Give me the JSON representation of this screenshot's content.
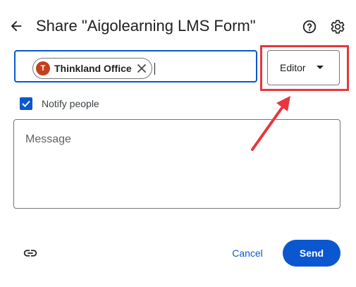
{
  "header": {
    "title": "Share \"Aigolearning LMS Form\""
  },
  "recipients": {
    "chips": [
      {
        "avatar_letter": "T",
        "label": "Thinkland Office",
        "avatar_color": "#c5401c"
      }
    ]
  },
  "role": {
    "selected": "Editor"
  },
  "notify": {
    "label": "Notify people",
    "checked": true
  },
  "message": {
    "placeholder": "Message"
  },
  "footer": {
    "cancel_label": "Cancel",
    "send_label": "Send"
  },
  "colors": {
    "accent": "#0b57d0",
    "annotation": "#e8363e"
  },
  "icons": {
    "back": "arrow-back-icon",
    "help": "help-icon",
    "settings": "gear-icon",
    "remove_chip": "close-icon",
    "dropdown": "caret-down-icon",
    "checkbox": "check-icon",
    "link": "link-icon"
  }
}
